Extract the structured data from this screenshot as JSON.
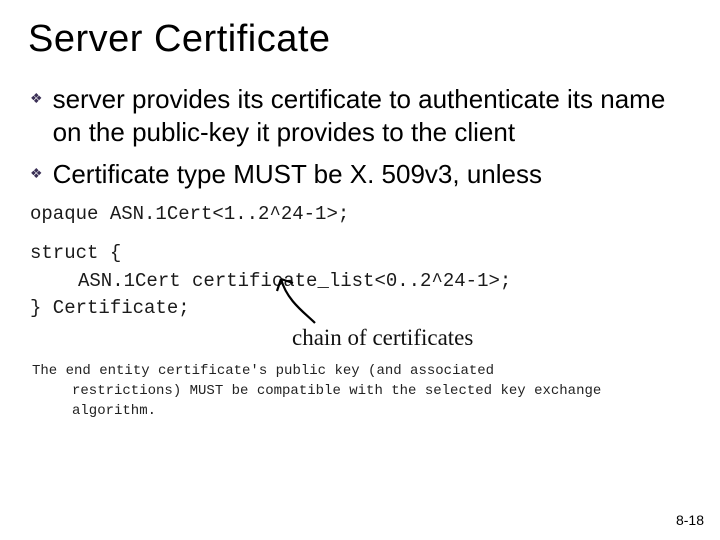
{
  "title": "Server Certificate",
  "bullets": [
    "server provides its certificate to authenticate its name on the public-key it provides to the client",
    "Certificate type MUST be X. 509v3, unless"
  ],
  "code": {
    "l0": "opaque ASN.1Cert<1..2^24-1>;",
    "l1": "struct {",
    "l2": "ASN.1Cert certificate_list<0..2^24-1>;",
    "l3": "} Certificate;"
  },
  "annotation": "chain of certificates",
  "footnote": {
    "l0": "The end entity certificate's public key (and associated",
    "l1": "restrictions) MUST be compatible with the selected key exchange",
    "l2": "algorithm."
  },
  "page": "8-18"
}
